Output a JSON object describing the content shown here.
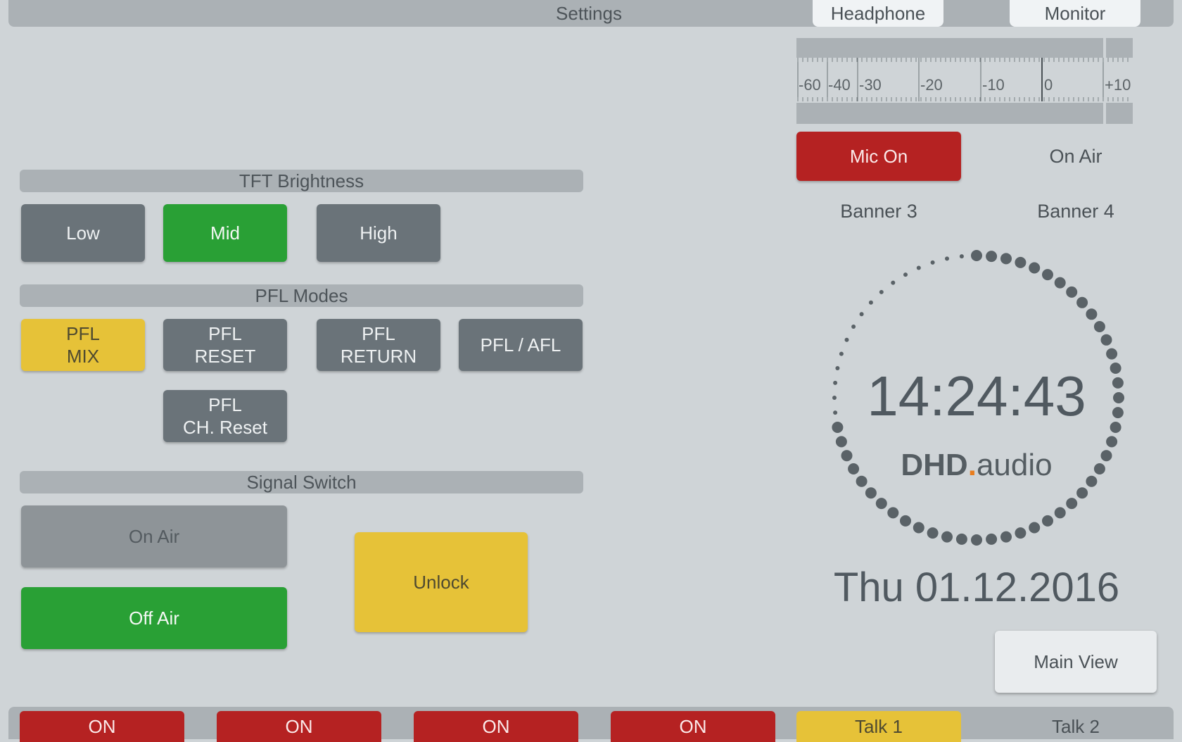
{
  "header": {
    "title": "Settings",
    "tabs": [
      {
        "label": "Headphone"
      },
      {
        "label": "Monitor"
      }
    ]
  },
  "meter": {
    "scale": [
      "-60",
      "-40",
      "-30",
      "-20",
      "-10",
      "0",
      "+10"
    ]
  },
  "tft_brightness": {
    "title": "TFT Brightness",
    "buttons": [
      {
        "label": "Low",
        "state": "off"
      },
      {
        "label": "Mid",
        "state": "on"
      },
      {
        "label": "High",
        "state": "off"
      }
    ]
  },
  "pfl_modes": {
    "title": "PFL Modes",
    "buttons": [
      {
        "label": "PFL\nMIX",
        "state": "on"
      },
      {
        "label": "PFL\nRESET",
        "state": "off"
      },
      {
        "label": "PFL\nRETURN",
        "state": "off"
      },
      {
        "label": "PFL / AFL",
        "state": "off"
      },
      {
        "label": "PFL\nCH. Reset",
        "state": "off"
      }
    ]
  },
  "signal_switch": {
    "title": "Signal Switch",
    "on_air": "On Air",
    "off_air": "Off Air",
    "unlock": "Unlock"
  },
  "status": {
    "mic_on": "Mic On",
    "on_air": "On Air",
    "banner3": "Banner 3",
    "banner4": "Banner 4"
  },
  "clock": {
    "time": "14:24:43",
    "seconds": 43,
    "brand_main": "DHD",
    "brand_dot": ".",
    "brand_sub": "audio",
    "date": "Thu 01.12.2016"
  },
  "main_view": "Main View",
  "bottom_bar": [
    {
      "label": "ON",
      "color": "red"
    },
    {
      "label": "ON",
      "color": "red"
    },
    {
      "label": "ON",
      "color": "red"
    },
    {
      "label": "ON",
      "color": "red"
    },
    {
      "label": "Talk 1",
      "color": "yellow"
    },
    {
      "label": "Talk 2",
      "color": "none"
    }
  ],
  "colors": {
    "accent_green": "#29a035",
    "accent_yellow": "#e6c238",
    "accent_red": "#b52222",
    "brand_orange": "#e87d1e"
  }
}
